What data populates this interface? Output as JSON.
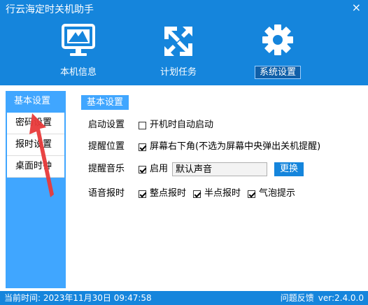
{
  "window": {
    "title": "行云海定时关机助手",
    "close_label": "×"
  },
  "toolbar": {
    "items": [
      {
        "label": "本机信息",
        "icon": "monitor-icon"
      },
      {
        "label": "计划任务",
        "icon": "transfer-arrows-icon"
      },
      {
        "label": "系统设置",
        "icon": "gear-icon",
        "active": true
      }
    ]
  },
  "sidebar": {
    "header": "基本设置",
    "items": [
      "密码设置",
      "报时设置",
      "桌面时钟"
    ]
  },
  "main": {
    "section_title": "基本设置",
    "startup": {
      "label": "启动设置",
      "option": "开机时自动启动",
      "checked": false
    },
    "reminder_position": {
      "label": "提醒位置",
      "option": "屏幕右下角(不选为屏幕中央弹出关机提醒)",
      "checked": true
    },
    "reminder_music": {
      "label": "提醒音乐",
      "enable_label": "启用",
      "checked": true,
      "sound_value": "默认声音",
      "change_button": "更换"
    },
    "voice": {
      "label": "语音报时",
      "options": [
        {
          "label": "整点报时",
          "checked": true
        },
        {
          "label": "半点报时",
          "checked": true
        },
        {
          "label": "气泡提示",
          "checked": true
        }
      ]
    }
  },
  "status": {
    "current_time": "当前时间: 2023年11月30日 09:47:58",
    "feedback": "问题反馈",
    "version": "ver:2.4.0.0"
  },
  "colors": {
    "primary": "#1585dc",
    "sidebar": "#40a6ff",
    "annotation_arrow": "#e83a3a"
  }
}
